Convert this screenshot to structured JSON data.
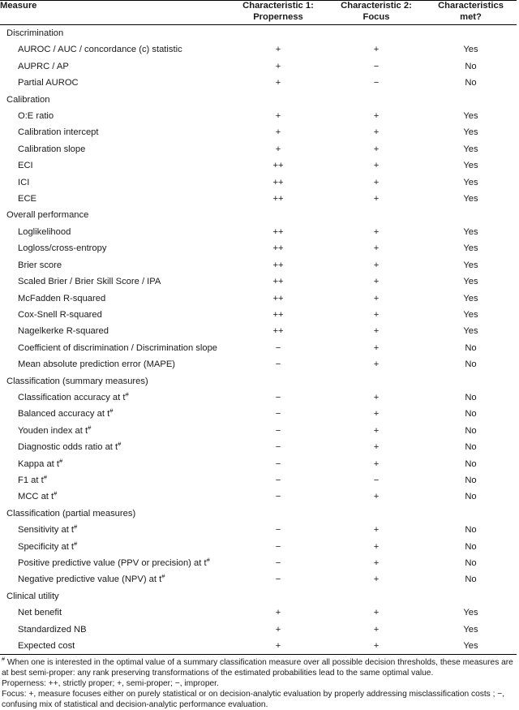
{
  "table": {
    "columns": [
      {
        "key": "measure",
        "header_lines": [
          "Measure"
        ],
        "align": "left"
      },
      {
        "key": "char1",
        "header_lines": [
          "Characteristic 1:",
          "Properness"
        ],
        "align": "center"
      },
      {
        "key": "char2",
        "header_lines": [
          "Characteristic 2:",
          "Focus"
        ],
        "align": "center"
      },
      {
        "key": "met",
        "header_lines": [
          "Characteristics",
          "met?"
        ],
        "align": "center"
      }
    ],
    "rows": [
      {
        "type": "section",
        "measure": "Discrimination",
        "char1": "",
        "char2": "",
        "met": ""
      },
      {
        "type": "item",
        "measure": "AUROC / AUC / concordance (c) statistic",
        "char1": "+",
        "char2": "+",
        "met": "Yes"
      },
      {
        "type": "item",
        "measure": "AUPRC / AP",
        "char1": "+",
        "char2": "−",
        "met": "No"
      },
      {
        "type": "item",
        "measure": "Partial AUROC",
        "char1": "+",
        "char2": "−",
        "met": "No"
      },
      {
        "type": "section",
        "measure": "Calibration",
        "char1": "",
        "char2": "",
        "met": ""
      },
      {
        "type": "item",
        "measure": "O:E ratio",
        "char1": "+",
        "char2": "+",
        "met": "Yes"
      },
      {
        "type": "item",
        "measure": "Calibration intercept",
        "char1": "+",
        "char2": "+",
        "met": "Yes"
      },
      {
        "type": "item",
        "measure": "Calibration slope",
        "char1": "+",
        "char2": "+",
        "met": "Yes"
      },
      {
        "type": "item",
        "measure": "ECI",
        "char1": "++",
        "char2": "+",
        "met": "Yes"
      },
      {
        "type": "item",
        "measure": "ICI",
        "char1": "++",
        "char2": "+",
        "met": "Yes"
      },
      {
        "type": "item",
        "measure": "ECE",
        "char1": "++",
        "char2": "+",
        "met": "Yes"
      },
      {
        "type": "section",
        "measure": "Overall performance",
        "char1": "",
        "char2": "",
        "met": ""
      },
      {
        "type": "item",
        "measure": "Loglikelihood",
        "char1": "++",
        "char2": "+",
        "met": "Yes"
      },
      {
        "type": "item",
        "measure": "Logloss/cross-entropy",
        "char1": "++",
        "char2": "+",
        "met": "Yes"
      },
      {
        "type": "item",
        "measure": "Brier score",
        "char1": "++",
        "char2": "+",
        "met": "Yes"
      },
      {
        "type": "item",
        "measure": "Scaled Brier / Brier Skill Score / IPA",
        "char1": "++",
        "char2": "+",
        "met": "Yes"
      },
      {
        "type": "item",
        "measure": "McFadden R-squared",
        "char1": "++",
        "char2": "+",
        "met": "Yes"
      },
      {
        "type": "item",
        "measure": "Cox-Snell R-squared",
        "char1": "++",
        "char2": "+",
        "met": "Yes"
      },
      {
        "type": "item",
        "measure": "Nagelkerke R-squared",
        "char1": "++",
        "char2": "+",
        "met": "Yes"
      },
      {
        "type": "item",
        "measure": "Coefficient of discrimination / Discrimination slope",
        "char1": "−",
        "char2": "+",
        "met": "No"
      },
      {
        "type": "item",
        "measure": "Mean absolute prediction error (MAPE)",
        "char1": "−",
        "char2": "+",
        "met": "No"
      },
      {
        "type": "section",
        "measure": "Classification (summary measures)",
        "char1": "",
        "char2": "",
        "met": ""
      },
      {
        "type": "item",
        "measure": "Classification accuracy at t",
        "sup": "#",
        "char1": "−",
        "char2": "+",
        "met": "No"
      },
      {
        "type": "item",
        "measure": "Balanced accuracy at t",
        "sup": "#",
        "char1": "−",
        "char2": "+",
        "met": "No"
      },
      {
        "type": "item",
        "measure": "Youden index at t",
        "sup": "#",
        "char1": "−",
        "char2": "+",
        "met": "No"
      },
      {
        "type": "item",
        "measure": "Diagnostic odds ratio at t",
        "sup": "#",
        "char1": "−",
        "char2": "+",
        "met": "No"
      },
      {
        "type": "item",
        "measure": "Kappa at t",
        "sup": "#",
        "char1": "−",
        "char2": "+",
        "met": "No"
      },
      {
        "type": "item",
        "measure": "F1 at t",
        "sup": "#",
        "char1": "−",
        "char2": "−",
        "met": "No"
      },
      {
        "type": "item",
        "measure": "MCC at t",
        "sup": "#",
        "char1": "−",
        "char2": "+",
        "met": "No"
      },
      {
        "type": "section",
        "measure": "Classification (partial measures)",
        "char1": "",
        "char2": "",
        "met": ""
      },
      {
        "type": "item",
        "measure": "Sensitivity at t",
        "sup": "#",
        "char1": "−",
        "char2": "+",
        "met": "No"
      },
      {
        "type": "item",
        "measure": "Specificity at t",
        "sup": "#",
        "char1": "−",
        "char2": "+",
        "met": "No"
      },
      {
        "type": "item",
        "measure": "Positive predictive value (PPV or precision) at t",
        "sup": "#",
        "char1": "−",
        "char2": "+",
        "met": "No"
      },
      {
        "type": "item",
        "measure": "Negative predictive value (NPV) at t",
        "sup": "#",
        "char1": "−",
        "char2": "+",
        "met": "No"
      },
      {
        "type": "section",
        "measure": "Clinical utility",
        "char1": "",
        "char2": "",
        "met": ""
      },
      {
        "type": "item",
        "measure": "Net benefit",
        "char1": "+",
        "char2": "+",
        "met": "Yes"
      },
      {
        "type": "item",
        "measure": "Standardized NB",
        "char1": "+",
        "char2": "+",
        "met": "Yes"
      },
      {
        "type": "item",
        "measure": "Expected cost",
        "char1": "+",
        "char2": "+",
        "met": "Yes"
      }
    ]
  },
  "footnotes": [
    {
      "marker": "#",
      "text": "When one is interested in the optimal value of a summary classification measure over all possible decision thresholds, these measures are at best semi-proper: any rank preserving transformations of the estimated probabilities lead to the same optimal value."
    },
    {
      "marker": "",
      "text": "Properness: ++, strictly proper; +, semi-proper; −, improper."
    },
    {
      "marker": "",
      "text": "Focus: +, measure focuses either on purely statistical or on decision-analytic evaluation by properly addressing misclassification costs ; −, confusing mix of statistical and decision-analytic performance evaluation."
    }
  ],
  "colors": {
    "text": "#1a1a1a",
    "rule": "#000000",
    "background": "#ffffff"
  }
}
